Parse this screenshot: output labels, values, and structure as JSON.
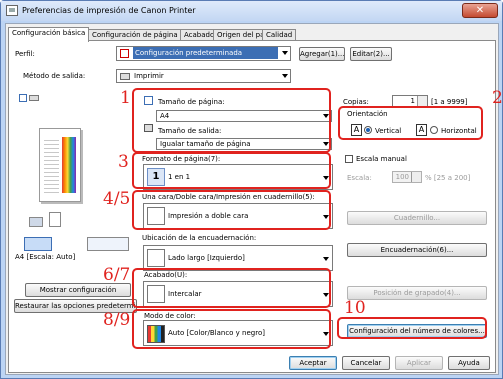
{
  "window": {
    "title": "Preferencias de impresión de Canon Printer",
    "close": "✕"
  },
  "tabs": [
    "Configuración básica",
    "Configuración de página",
    "Acabado",
    "Origen del papel",
    "Calidad"
  ],
  "profile": {
    "label": "Perfil:",
    "value": "Configuración predeterminada",
    "add": "Agregar(1)...",
    "edit": "Editar(2)..."
  },
  "output": {
    "label": "Método de salida:",
    "value": "Imprimir"
  },
  "page_size": {
    "label": "Tamaño de página:",
    "value": "A4"
  },
  "output_size": {
    "label": "Tamaño de salida:",
    "value": "Igualar tamaño de página"
  },
  "copies": {
    "label": "Copias:",
    "value": "1",
    "range": "[1 a 9999]"
  },
  "orientation": {
    "label": "Orientación",
    "vertical": "Vertical",
    "horizontal": "Horizontal",
    "icon_letter": "A"
  },
  "layout": {
    "label": "Formato de página(7):",
    "value": "1 en 1",
    "icon_text": "1"
  },
  "manual_scale": {
    "label": "Escala manual",
    "scale_label": "Escala:",
    "value": "100",
    "range": "% [25 a 200]"
  },
  "duplex": {
    "label": "Una cara/Doble cara/Impresión en cuadernillo(5):",
    "value": "Impresión a doble cara"
  },
  "booklet_button": "Cuadernillo...",
  "binding": {
    "label": "Ubicación de la encuadernación:",
    "value": "Lado largo [Izquierdo]",
    "button": "Encuadernación(6)..."
  },
  "finishing": {
    "label": "Acabado(U):",
    "value": "Intercalar",
    "staple_button": "Posición de grapado(4)..."
  },
  "color": {
    "label": "Modo de color:",
    "value": "Auto [Color/Blanco y negro]",
    "button": "Configuración del número de colores..."
  },
  "preview": {
    "caption": "A4 [Escala: Auto]",
    "show_settings": "Mostrar configuración",
    "restore_defaults": "Restaurar las opciones predeterminadas"
  },
  "dialog_buttons": {
    "ok": "Aceptar",
    "cancel": "Cancelar",
    "apply": "Aplicar",
    "help": "Ayuda"
  },
  "callouts": {
    "c1": "1",
    "c2": "2",
    "c3": "3",
    "c45": "4/5",
    "c67": "6/7",
    "c89": "8/9",
    "c10": "10"
  },
  "colors": {
    "callout": "#e0231f",
    "titlebar": "#c3d7f3",
    "selection": "#3c6eb4"
  }
}
